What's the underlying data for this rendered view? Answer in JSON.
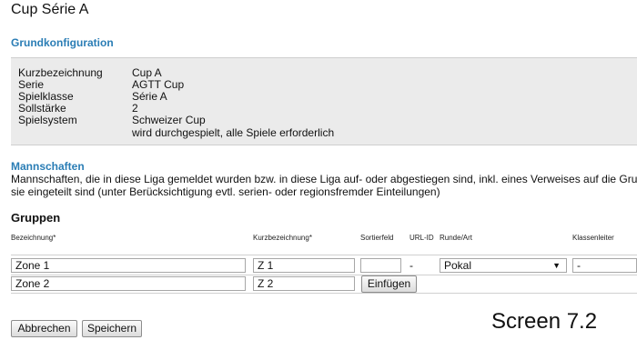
{
  "page": {
    "title": "Cup Série A"
  },
  "grundkonfiguration": {
    "heading": "Grundkonfiguration",
    "rows": [
      {
        "label": "Kurzbezeichnung",
        "value": "Cup A"
      },
      {
        "label": "Serie",
        "value": "AGTT Cup"
      },
      {
        "label": "Spielklasse",
        "value": "Série A"
      },
      {
        "label": "Sollstärke",
        "value": "2"
      },
      {
        "label": "Spielsystem",
        "value": "Schweizer Cup"
      },
      {
        "label": "",
        "value": "wird durchgespielt, alle Spiele erforderlich"
      }
    ]
  },
  "mannschaften": {
    "heading": "Mannschaften",
    "line1": "Mannschaften, die in diese Liga gemeldet wurden bzw. in diese Liga auf- oder abgestiegen sind, inkl. eines Verweises auf die Gruppe, in welc",
    "line2": "sie eingeteilt sind (unter Berücksichtigung evtl. serien- oder regionsfremder Einteilungen)"
  },
  "gruppen": {
    "heading": "Gruppen",
    "columns": {
      "bezeichnung": "Bezeichnung*",
      "kurzbezeichnung": "Kurzbezeichnung*",
      "sortierfeld": "Sortierfeld",
      "url_id": "URL-ID",
      "runde_art": "Runde/Art",
      "klassenleiter": "Klassenleiter"
    },
    "rows": [
      {
        "bezeichnung": "Zone 1",
        "kurz": "Z 1",
        "sortierfeld": "",
        "url_id": "-",
        "runde_art": "Pokal",
        "klassenleiter": "-"
      },
      {
        "bezeichnung": "Zone 2",
        "kurz": "Z 2",
        "insert_label": "Einfügen"
      }
    ]
  },
  "footer": {
    "cancel_label": "Abbrechen",
    "save_label": "Speichern",
    "screen_label": "Screen 7.2"
  }
}
